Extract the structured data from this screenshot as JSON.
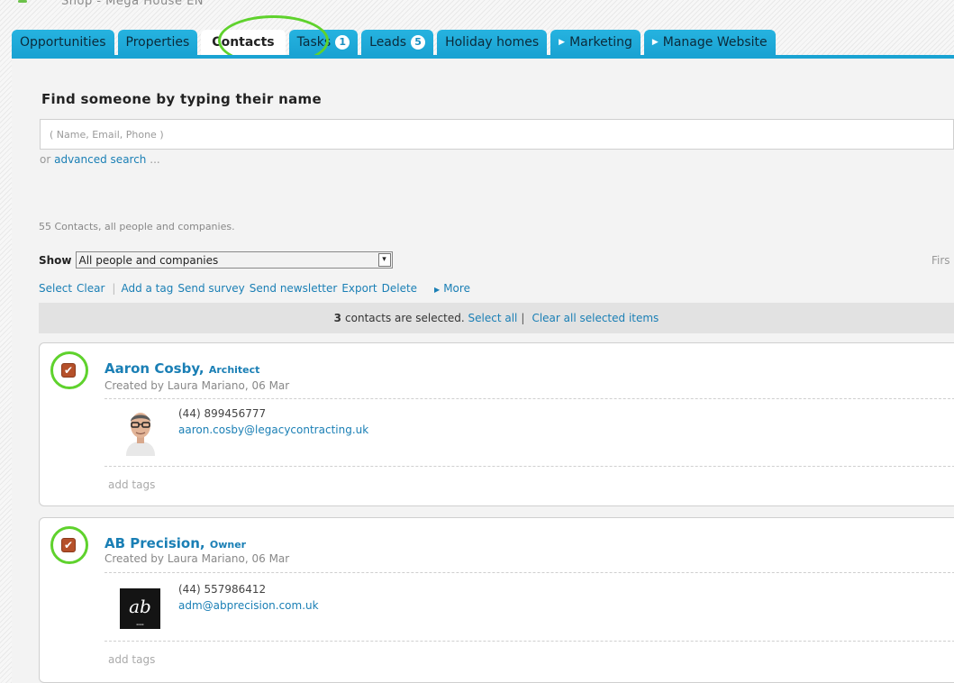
{
  "site": {
    "title": "Shop - Mega House EN"
  },
  "tabs": [
    {
      "label": "Opportunities",
      "badge": "",
      "arrow": false,
      "active": false
    },
    {
      "label": "Properties",
      "badge": "",
      "arrow": false,
      "active": false
    },
    {
      "label": "Contacts",
      "badge": "",
      "arrow": false,
      "active": true
    },
    {
      "label": "Tasks",
      "badge": "1",
      "arrow": false,
      "active": false
    },
    {
      "label": "Leads",
      "badge": "5",
      "arrow": false,
      "active": false
    },
    {
      "label": "Holiday homes",
      "badge": "",
      "arrow": false,
      "active": false
    },
    {
      "label": "Marketing",
      "badge": "",
      "arrow": true,
      "active": false
    },
    {
      "label": "Manage Website",
      "badge": "",
      "arrow": true,
      "active": false
    }
  ],
  "search": {
    "title": "Find someone by typing their name",
    "placeholder": "( Name, Email, Phone )",
    "or_text": "or",
    "advanced_label": "advanced search",
    "advanced_suffix": "..."
  },
  "summary": {
    "count_text": "55 Contacts, all people and companies."
  },
  "filter": {
    "show_label": "Show",
    "selected": "All people and companies",
    "first_label": "Firs"
  },
  "actions": {
    "select": "Select",
    "clear": "Clear",
    "add_tag": "Add a tag",
    "send_survey": "Send survey",
    "send_newsletter": "Send newsletter",
    "export": "Export",
    "delete": "Delete",
    "more": "More"
  },
  "selection": {
    "count": "3",
    "text": "contacts are selected.",
    "select_all": "Select all",
    "clear_all": "Clear all selected items"
  },
  "contacts": [
    {
      "name": "Aaron Cosby,",
      "role": "Architect",
      "created": "Created by Laura Mariano, 06 Mar",
      "phone": "(44) 899456777",
      "email": "aaron.cosby@legacycontracting.uk",
      "tags": "add tags",
      "checked": true
    },
    {
      "name": "AB Precision,",
      "role": "Owner",
      "created": "Created by Laura Mariano, 06 Mar",
      "phone": "(44) 557986412",
      "email": "adm@abprecision.com.uk",
      "tags": "add tags",
      "checked": true,
      "logo_text": "ab"
    }
  ],
  "colors": {
    "tab_blue": "#1aa3d3",
    "link_blue": "#1a7fb5",
    "highlight_green": "#5fd22d",
    "checkbox": "#b5502a"
  }
}
